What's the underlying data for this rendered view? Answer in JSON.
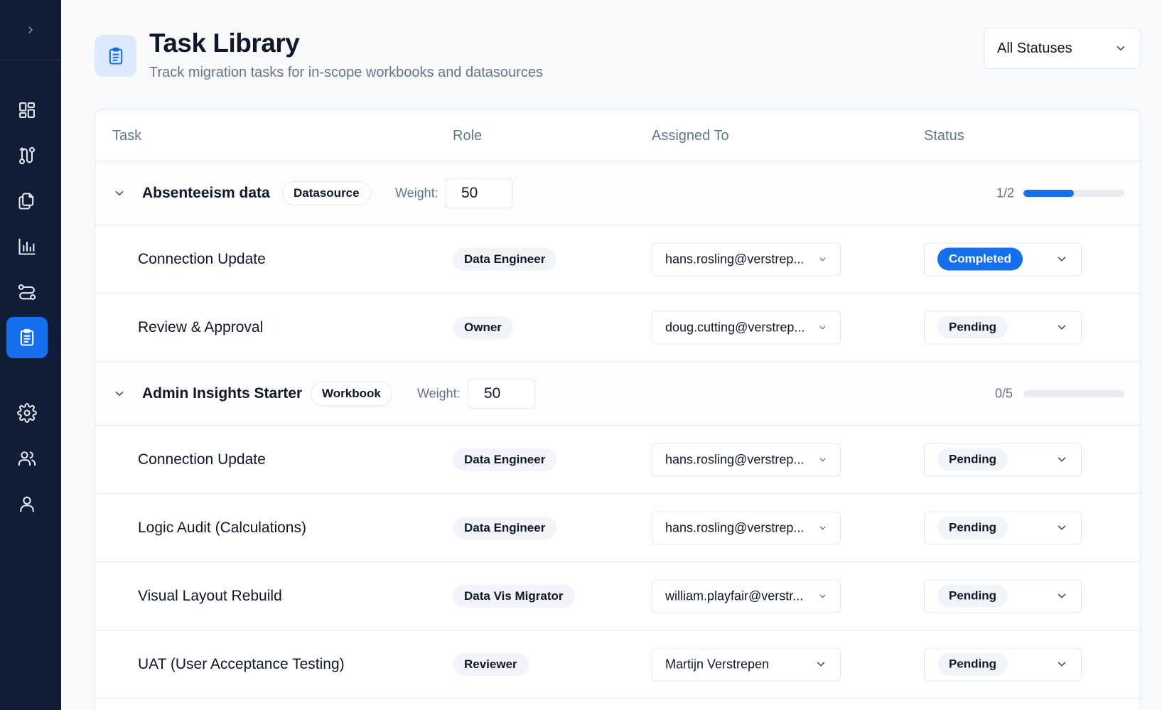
{
  "header": {
    "title": "Task Library",
    "subtitle": "Track migration tasks for in-scope workbooks and datasources",
    "status_filter": "All Statuses"
  },
  "sidebar": {
    "items": [
      {
        "name": "dashboard",
        "icon": "grid-icon",
        "active": false
      },
      {
        "name": "migration",
        "icon": "route-icon",
        "active": false
      },
      {
        "name": "assets",
        "icon": "files-icon",
        "active": false
      },
      {
        "name": "analytics",
        "icon": "bar-chart-icon",
        "active": false
      },
      {
        "name": "workflows",
        "icon": "flow-icon",
        "active": false
      },
      {
        "name": "task-library",
        "icon": "clipboard-icon",
        "active": true
      },
      {
        "name": "settings",
        "icon": "gear-icon",
        "active": false
      },
      {
        "name": "team",
        "icon": "users-icon",
        "active": false
      },
      {
        "name": "profile",
        "icon": "user-icon",
        "active": false
      }
    ]
  },
  "table": {
    "columns": [
      "Task",
      "Role",
      "Assigned To",
      "Status"
    ],
    "weight_label": "Weight:",
    "groups": [
      {
        "name": "Absenteeism data",
        "type": "Datasource",
        "weight": "50",
        "progress_text": "1/2",
        "progress_fraction": 0.5,
        "tasks": [
          {
            "name": "Connection Update",
            "role": "Data Engineer",
            "assignee": "hans.rosling@verstrep...",
            "status": "Completed"
          },
          {
            "name": "Review & Approval",
            "role": "Owner",
            "assignee": "doug.cutting@verstrep...",
            "status": "Pending"
          }
        ]
      },
      {
        "name": "Admin Insights Starter",
        "type": "Workbook",
        "weight": "50",
        "progress_text": "0/5",
        "progress_fraction": 0,
        "tasks": [
          {
            "name": "Connection Update",
            "role": "Data Engineer",
            "assignee": "hans.rosling@verstrep...",
            "status": "Pending"
          },
          {
            "name": "Logic Audit (Calculations)",
            "role": "Data Engineer",
            "assignee": "hans.rosling@verstrep...",
            "status": "Pending"
          },
          {
            "name": "Visual Layout Rebuild",
            "role": "Data Vis Migrator",
            "assignee": "william.playfair@verstr...",
            "status": "Pending"
          },
          {
            "name": "UAT (User Acceptance Testing)",
            "role": "Reviewer",
            "assignee": "Martijn Verstrepen",
            "status": "Pending"
          }
        ]
      }
    ]
  },
  "colors": {
    "sidebar_bg": "#0f1e36",
    "accent": "#1570ef",
    "page_bg": "#f8fafc"
  }
}
